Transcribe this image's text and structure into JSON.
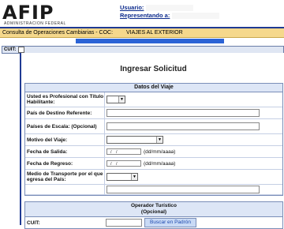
{
  "header": {
    "logo_text": "AFIP",
    "logo_sub": "ADMINISTRACION FEDERAL",
    "user_label": "Usuario:",
    "rep_label": "Representando a:"
  },
  "crumb": {
    "title": "Consulta de Operaciones Cambiarias - COC:",
    "destination": "VIAJES AL EXTERIOR"
  },
  "cuit_label": "CUIT:",
  "page_title": "Ingresar Solicitud",
  "section_viaje": {
    "heading": "Datos del Viaje",
    "fields": {
      "profesional": "Usted es Profesional con Título Habilitante:",
      "pais_destino": "País de Destino Referente:",
      "paises_escala": "Países de Escala: (Opcional)",
      "motivo": "Motivo del Viaje:",
      "fecha_salida": "Fecha de Salida:",
      "fecha_regreso": "Fecha de Regreso:",
      "transporte": "Medio de Transporte por el que egresa del País:"
    },
    "date_placeholder": "/ /",
    "date_hint": "(dd/mm/aaaa)"
  },
  "section_operador": {
    "heading": "Operador Turístico",
    "subheading": "(Opcional)",
    "cuit_label": "CUIT:",
    "search_button": "Buscar en Padrón"
  },
  "colors": {
    "brand_blue": "#1f3a93",
    "crumb_bg": "#f5d88c",
    "section_bg": "#dde6f6"
  }
}
